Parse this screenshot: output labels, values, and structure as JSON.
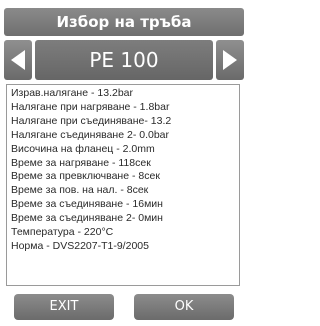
{
  "header": {
    "title": "Избор на тръба"
  },
  "pipe_selector": {
    "value": "PE 100",
    "prev_icon": "left-triangle-icon",
    "next_icon": "right-triangle-icon"
  },
  "parameters": [
    "Израв.налягане - 13.2bar",
    "Налягане при нагряване - 1.8bar",
    "Налягане при съединяване- 13.2",
    "Налягане съединяване 2- 0.0bar",
    "Височина на фланец - 2.0mm",
    "Време за нагряване - 118сек",
    "Време за превключване - 8сек",
    "Време за пов. на нал. - 8сек",
    "Време за съединяване - 16мин",
    "Време за съединяване 2- 0мин",
    "Температура - 220°C",
    "Норма - DVS2207-T1-9/2005"
  ],
  "footer": {
    "exit_label": "EXIT",
    "ok_label": "OK"
  },
  "colors": {
    "button_gray": "#7a7a7a",
    "text_dark": "#2a2a2a"
  }
}
